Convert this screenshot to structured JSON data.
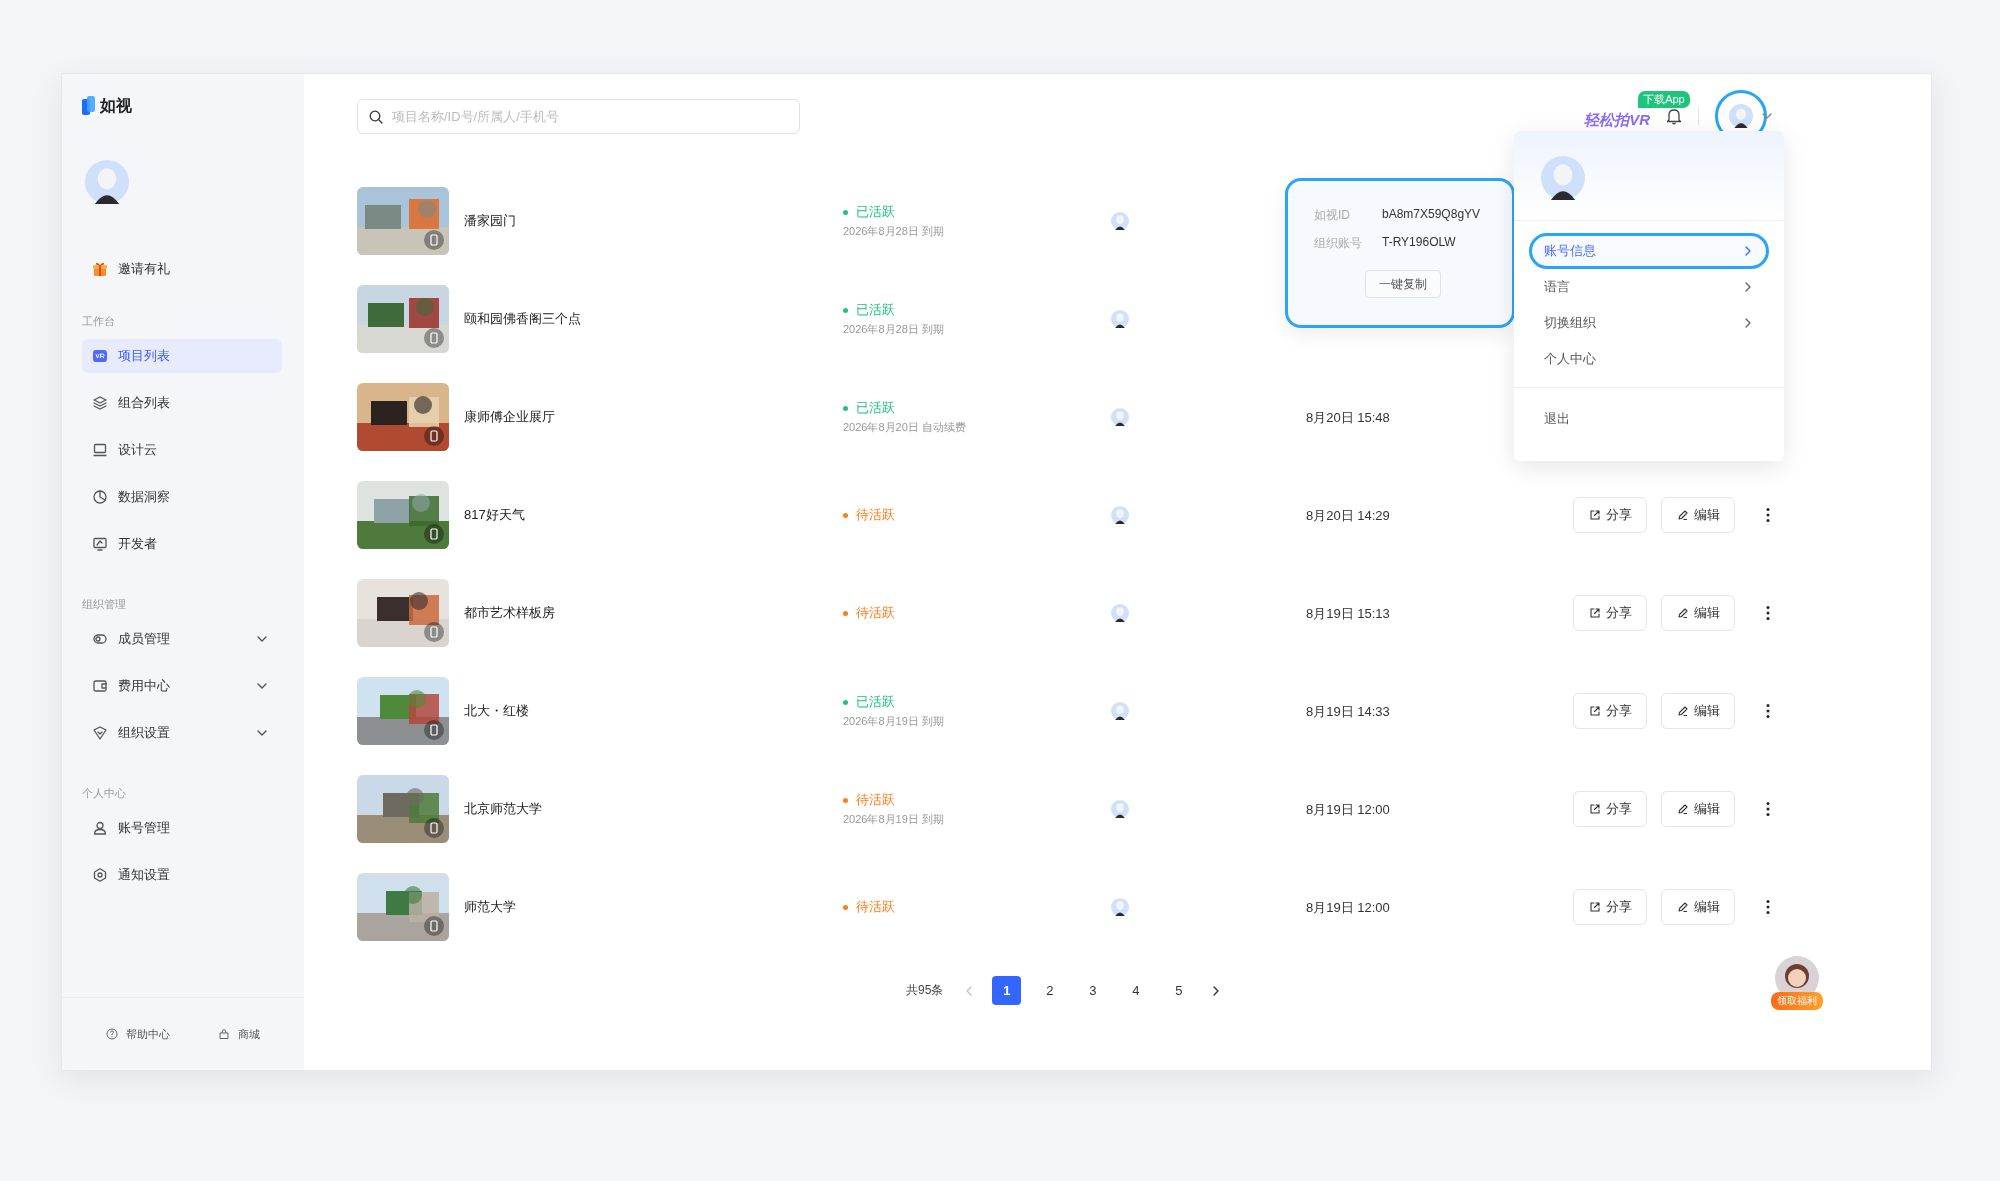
{
  "logo": {
    "text": "如视"
  },
  "sidebar": {
    "invite": {
      "label": "邀请有礼"
    },
    "sections": [
      {
        "title": "工作台",
        "items": [
          {
            "label": "项目列表",
            "selected": true,
            "expandable": false
          },
          {
            "label": "组合列表",
            "selected": false,
            "expandable": false
          },
          {
            "label": "设计云",
            "selected": false,
            "expandable": false
          },
          {
            "label": "数据洞察",
            "selected": false,
            "expandable": false
          },
          {
            "label": "开发者",
            "selected": false,
            "expandable": false
          }
        ]
      },
      {
        "title": "组织管理",
        "items": [
          {
            "label": "成员管理",
            "selected": false,
            "expandable": true
          },
          {
            "label": "费用中心",
            "selected": false,
            "expandable": true
          },
          {
            "label": "组织设置",
            "selected": false,
            "expandable": true
          }
        ]
      },
      {
        "title": "个人中心",
        "items": [
          {
            "label": "账号管理",
            "selected": false,
            "expandable": false
          },
          {
            "label": "通知设置",
            "selected": false,
            "expandable": false
          }
        ]
      }
    ],
    "footer": [
      {
        "label": "帮助中心"
      },
      {
        "label": "商城"
      }
    ]
  },
  "search": {
    "placeholder": "项目名称/ID号/所属人/手机号"
  },
  "header": {
    "promo": "轻松拍VR",
    "promo_badge": "下载App"
  },
  "projects": [
    {
      "name": "潘家园门",
      "status": {
        "label": "已活跃",
        "color": "#1ec47c"
      },
      "expiry": "2026年8月28日 到期"
    },
    {
      "name": "颐和园佛香阁三个点",
      "status": {
        "label": "已活跃",
        "color": "#1ec47c"
      },
      "expiry": "2026年8月28日 到期"
    },
    {
      "name": "康师傅企业展厅",
      "status": {
        "label": "已活跃",
        "color": "#1ec47c"
      },
      "expiry": "2026年8月20日 自动续费",
      "time": "8月20日 15:48"
    },
    {
      "name": "817好天气",
      "status": {
        "label": "待活跃",
        "color": "#ff7d1a"
      },
      "time": "8月20日 14:29",
      "actions": [
        {
          "label": "分享",
          "kind": "share"
        },
        {
          "label": "编辑",
          "kind": "edit"
        }
      ]
    },
    {
      "name": "都市艺术样板房",
      "status": {
        "label": "待活跃",
        "color": "#ff7d1a"
      },
      "time": "8月19日 15:13",
      "actions": [
        {
          "label": "分享",
          "kind": "share"
        },
        {
          "label": "编辑",
          "kind": "edit"
        }
      ]
    },
    {
      "name": "北大・红楼",
      "status": {
        "label": "已活跃",
        "color": "#1ec47c"
      },
      "expiry": "2026年8月19日 到期",
      "time": "8月19日 14:33",
      "actions": [
        {
          "label": "分享",
          "kind": "share"
        },
        {
          "label": "编辑",
          "kind": "edit"
        }
      ]
    },
    {
      "name": "北京师范大学",
      "status": {
        "label": "待活跃",
        "color": "#ff7d1a"
      },
      "expiry": "2026年8月19日 到期",
      "time": "8月19日 12:00",
      "actions": [
        {
          "label": "分享",
          "kind": "share"
        },
        {
          "label": "编辑",
          "kind": "edit"
        }
      ]
    },
    {
      "name": "师范大学",
      "status": {
        "label": "待活跃",
        "color": "#ff7d1a"
      },
      "time": "8月19日 12:00",
      "actions": [
        {
          "label": "分享",
          "kind": "share"
        },
        {
          "label": "编辑",
          "kind": "edit"
        }
      ]
    }
  ],
  "pagination": {
    "total": "共95条",
    "prev_disabled": true,
    "pages": [
      {
        "label": "1",
        "selected": true
      },
      {
        "label": "2",
        "selected": false
      },
      {
        "label": "3",
        "selected": false
      },
      {
        "label": "4",
        "selected": false
      },
      {
        "label": "5",
        "selected": false
      }
    ]
  },
  "account_popover": {
    "fields": [
      {
        "label": "如视ID",
        "value": "bA8m7X59Q8gYV"
      },
      {
        "label": "组织账号",
        "value": "T-RY196OLW"
      }
    ],
    "copy_button": "一键复制"
  },
  "user_menu": {
    "items": [
      {
        "label": "账号信息",
        "selected": true,
        "submenu": true
      },
      {
        "label": "语言",
        "selected": false,
        "submenu": true
      },
      {
        "label": "切换组织",
        "selected": false,
        "submenu": true
      },
      {
        "label": "个人中心",
        "selected": false,
        "submenu": false
      }
    ],
    "logout": "退出"
  },
  "helper": {
    "badge": "领取福利"
  }
}
